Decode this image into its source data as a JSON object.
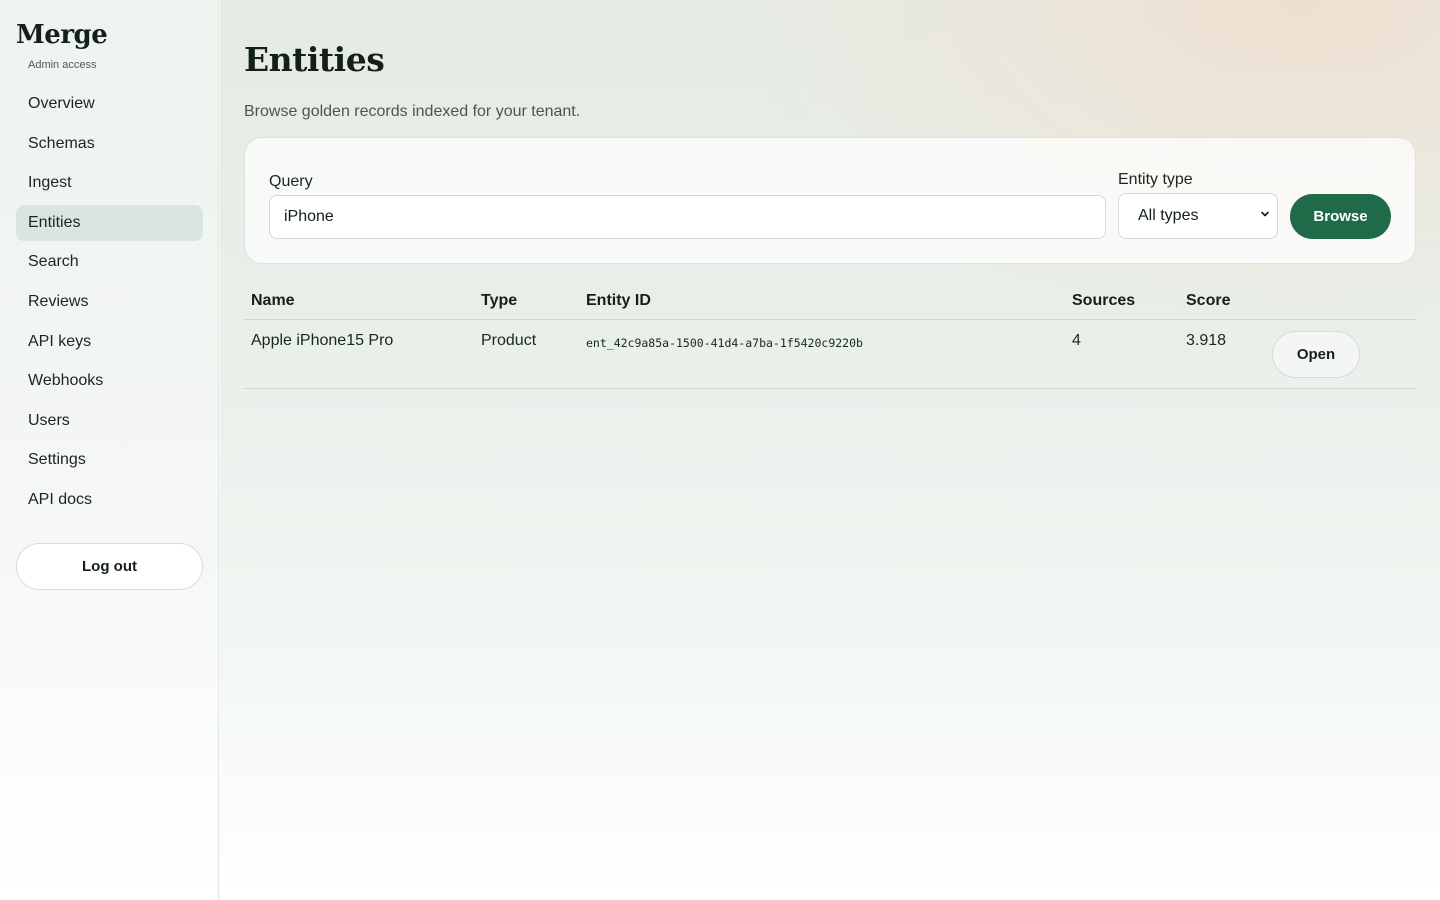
{
  "sidebar": {
    "brand": "Merge",
    "subtitle": "Admin access",
    "items": [
      {
        "label": "Overview",
        "active": false
      },
      {
        "label": "Schemas",
        "active": false
      },
      {
        "label": "Ingest",
        "active": false
      },
      {
        "label": "Entities",
        "active": true
      },
      {
        "label": "Search",
        "active": false
      },
      {
        "label": "Reviews",
        "active": false
      },
      {
        "label": "API keys",
        "active": false
      },
      {
        "label": "Webhooks",
        "active": false
      },
      {
        "label": "Users",
        "active": false
      },
      {
        "label": "Settings",
        "active": false
      },
      {
        "label": "API docs",
        "active": false
      }
    ],
    "logout_label": "Log out"
  },
  "header": {
    "title": "Entities",
    "description": "Browse golden records indexed for your tenant."
  },
  "filters": {
    "query_label": "Query",
    "query_value": "iPhone",
    "type_label": "Entity type",
    "type_value": "All types",
    "browse_label": "Browse"
  },
  "table": {
    "columns": [
      "Name",
      "Type",
      "Entity ID",
      "Sources",
      "Score"
    ],
    "rows": [
      {
        "name": "Apple iPhone15 Pro",
        "type": "Product",
        "id": "ent_42c9a85a-1500-41d4-a7ba-1f5420c9220b",
        "sources": "4",
        "score": "3.918",
        "action": "Open"
      }
    ]
  },
  "colors": {
    "accent": "#1f6a49",
    "active_nav": "#dbe5df"
  }
}
